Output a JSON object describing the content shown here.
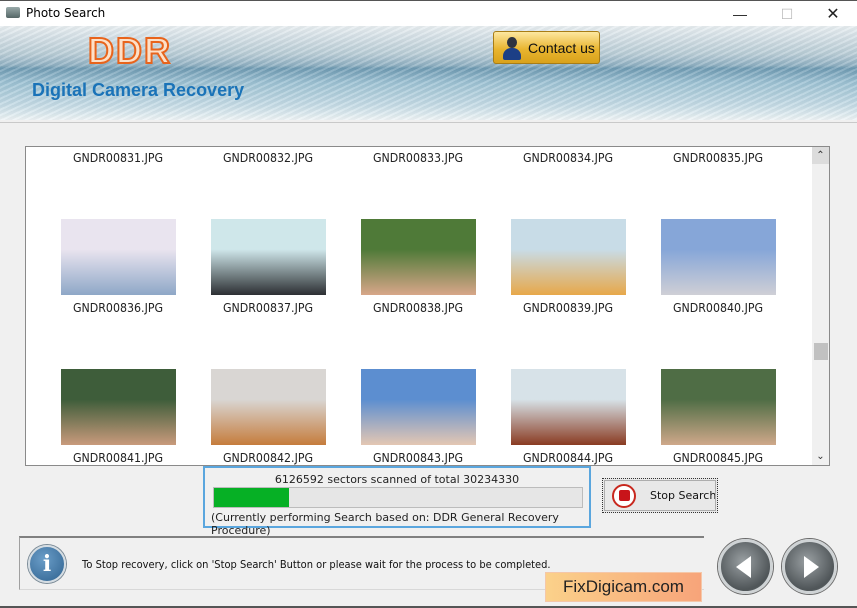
{
  "window": {
    "title": "Photo Search",
    "minimize": "—",
    "maximize": "☐",
    "close": "✕"
  },
  "header": {
    "logo": "DDR",
    "subtitle": "Digital Camera Recovery",
    "contact_label": "Contact us"
  },
  "gallery": {
    "rows": [
      {
        "has_thumbs": false,
        "items": [
          {
            "name": "GNDR00831.JPG"
          },
          {
            "name": "GNDR00832.JPG"
          },
          {
            "name": "GNDR00833.JPG"
          },
          {
            "name": "GNDR00834.JPG"
          },
          {
            "name": "GNDR00835.JPG"
          }
        ]
      },
      {
        "has_thumbs": true,
        "items": [
          {
            "name": "GNDR00836.JPG",
            "thumb_colors": [
              "#e9e4ef",
              "#8ea7c7"
            ]
          },
          {
            "name": "GNDR00837.JPG",
            "thumb_colors": [
              "#cfe7ea",
              "#2c2f33"
            ]
          },
          {
            "name": "GNDR00838.JPG",
            "thumb_colors": [
              "#4f7a38",
              "#d8a689"
            ]
          },
          {
            "name": "GNDR00839.JPG",
            "thumb_colors": [
              "#c8dce7",
              "#e7a84a"
            ]
          },
          {
            "name": "GNDR00840.JPG",
            "thumb_colors": [
              "#86a6d8",
              "#cfcfd6"
            ]
          }
        ]
      },
      {
        "has_thumbs": true,
        "items": [
          {
            "name": "GNDR00841.JPG",
            "thumb_colors": [
              "#3e5d3a",
              "#c99a7c"
            ]
          },
          {
            "name": "GNDR00842.JPG",
            "thumb_colors": [
              "#d9d6d3",
              "#c57c3c"
            ]
          },
          {
            "name": "GNDR00843.JPG",
            "thumb_colors": [
              "#5c8ed0",
              "#e4c7b3"
            ]
          },
          {
            "name": "GNDR00844.JPG",
            "thumb_colors": [
              "#d7e2e8",
              "#8a3b22"
            ]
          },
          {
            "name": "GNDR00845.JPG",
            "thumb_colors": [
              "#4f6d45",
              "#cfa88a"
            ]
          }
        ]
      }
    ],
    "scroll_up": "⌃",
    "scroll_down": "⌄"
  },
  "progress": {
    "status_text": "6126592 sectors scanned of total 30234330",
    "sectors_scanned": 6126592,
    "sectors_total": 30234330,
    "fraction": 0.2026,
    "note": "(Currently performing Search based on:  DDR General Recovery Procedure)",
    "fill_color": "#06b025"
  },
  "stop_button": {
    "label": "Stop Search"
  },
  "info": {
    "icon_glyph": "i",
    "message": "To Stop recovery, click on 'Stop Search' Button or please wait for the process to be completed."
  },
  "brand": "FixDigicam.com"
}
